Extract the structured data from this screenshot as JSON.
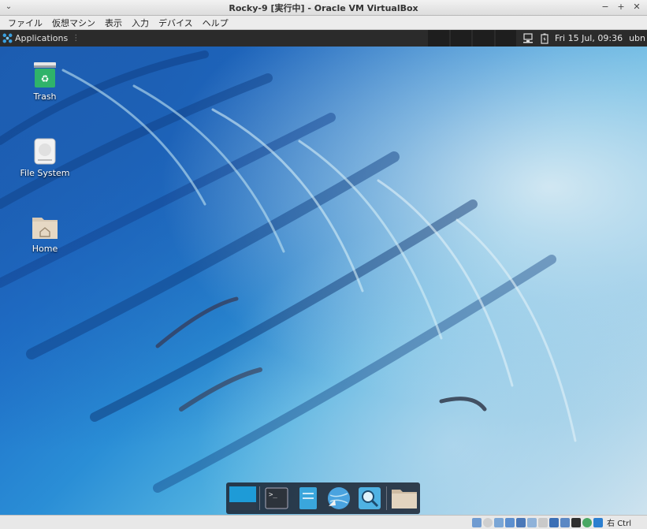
{
  "window": {
    "title": "Rocky-9 [実行中] - Oracle VM VirtualBox",
    "menu_icon": "chevron-down-icon",
    "controls": [
      "minimize-icon",
      "maximize-icon",
      "close-icon"
    ]
  },
  "vbox_menu": {
    "items": [
      "ファイル",
      "仮想マシン",
      "表示",
      "入力",
      "デバイス",
      "ヘルプ"
    ]
  },
  "panel": {
    "applications_label": "Applications",
    "clock": "Fri 15 Jul, 09:36",
    "user": "ubn",
    "tray_icons": [
      "network-icon",
      "battery-icon"
    ]
  },
  "desktop_icons": [
    {
      "label": "Trash",
      "icon": "trash-icon"
    },
    {
      "label": "File System",
      "icon": "drive-icon"
    },
    {
      "label": "Home",
      "icon": "home-folder-icon"
    }
  ],
  "dock": {
    "items": [
      "show-desktop-icon",
      "terminal-icon",
      "file-manager-icon",
      "web-browser-icon",
      "search-icon",
      "folder-icon"
    ]
  },
  "statusbar": {
    "host_key": "右 Ctrl"
  },
  "colors": {
    "panel_bg": "#2b2b2b",
    "accent": "#1e88c9"
  }
}
